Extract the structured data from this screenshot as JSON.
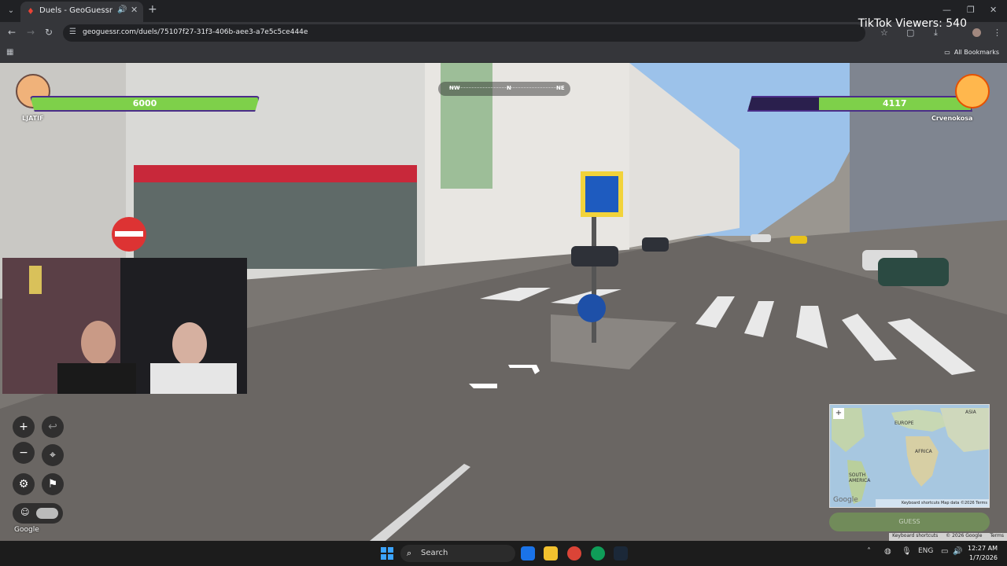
{
  "browser": {
    "tab_title": "Duels - GeoGuessr",
    "url": "geoguessr.com/duels/75107f27-31f3-406b-aee3-a7e5c5ce444e",
    "bookmarks_label": "All Bookmarks"
  },
  "overlay": {
    "tiktok_viewers": "TikTok Viewers: 540"
  },
  "duel": {
    "player1": {
      "name": "LJATIF",
      "health": "6000",
      "health_fraction": 1.0,
      "color": "#7ed04a"
    },
    "player2": {
      "name": "Crvenokosa",
      "health": "4117",
      "health_fraction": 0.686,
      "color": "#7ed04a"
    },
    "compass": [
      "NW",
      "N",
      "NE"
    ]
  },
  "controls": {
    "zoom_in": "+",
    "zoom_out": "−",
    "undo": "↩",
    "settings": "⚙",
    "flag": "⚑",
    "pin": "⌖"
  },
  "minimap": {
    "labels": {
      "asia": "ASIA",
      "europe": "EUROPE",
      "africa": "AFRICA",
      "south_america": "SOUTH AMERICA"
    },
    "zoom": "+",
    "footer": "Keyboard shortcuts   Map data ©2026   Terms",
    "logo": "Google",
    "guess_label": "GUESS"
  },
  "scene_footer": {
    "shortcuts": "Keyboard shortcuts",
    "data": "© 2026 Google",
    "terms": "Terms"
  },
  "google_logo": "Google",
  "taskbar": {
    "search_label": "Search",
    "language": "ENG",
    "time": "12:27 AM",
    "date": "1/7/2026"
  }
}
